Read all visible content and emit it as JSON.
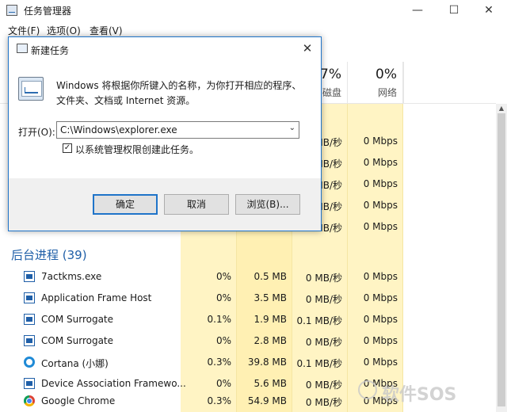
{
  "window": {
    "title": "任务管理器",
    "minimize": "—",
    "maximize": "☐",
    "close": "✕"
  },
  "menu": [
    "文件(F)",
    "选项(O)",
    "查看(V)"
  ],
  "columns": [
    {
      "pct": "",
      "name": ""
    },
    {
      "pct": "",
      "name": ""
    },
    {
      "pct": "7%",
      "name": "磁盘"
    },
    {
      "pct": "0%",
      "name": "网络"
    }
  ],
  "hidden_rows": [
    {
      "disk": "MB/秒",
      "net": "0 Mbps"
    },
    {
      "disk": "MB/秒",
      "net": "0 Mbps"
    },
    {
      "disk": "MB/秒",
      "net": "0 Mbps"
    },
    {
      "disk": "MB/秒",
      "net": "0 Mbps"
    },
    {
      "disk": "MB/秒",
      "net": "0 Mbps"
    }
  ],
  "group": {
    "label": "后台进程 (39)"
  },
  "processes": [
    {
      "name": "7actkms.exe",
      "icon": "window-icon",
      "cpu": "0%",
      "mem": "0.5 MB",
      "disk": "0 MB/秒",
      "net": "0 Mbps"
    },
    {
      "name": "Application Frame Host",
      "icon": "window-icon",
      "cpu": "0%",
      "mem": "3.5 MB",
      "disk": "0 MB/秒",
      "net": "0 Mbps"
    },
    {
      "name": "COM Surrogate",
      "icon": "window-icon",
      "cpu": "0.1%",
      "mem": "1.9 MB",
      "disk": "0.1 MB/秒",
      "net": "0 Mbps"
    },
    {
      "name": "COM Surrogate",
      "icon": "window-icon",
      "cpu": "0%",
      "mem": "2.8 MB",
      "disk": "0 MB/秒",
      "net": "0 Mbps"
    },
    {
      "name": "Cortana (小娜)",
      "icon": "cortana-icon",
      "cpu": "0.3%",
      "mem": "39.8 MB",
      "disk": "0.1 MB/秒",
      "net": "0 Mbps"
    },
    {
      "name": "Device Association Framewo...",
      "icon": "window-icon",
      "cpu": "0%",
      "mem": "5.6 MB",
      "disk": "0 MB/秒",
      "net": "0 Mbps"
    },
    {
      "name": "Google Chrome",
      "icon": "chrome-icon",
      "cpu": "0.3%",
      "mem": "54.9 MB",
      "disk": "0 MB/秒",
      "net": "0 Mbps"
    }
  ],
  "dialog": {
    "title": "新建任务",
    "close": "✕",
    "description": "Windows 将根据你所键入的名称，为你打开相应的程序、文件夹、文档或 Internet 资源。",
    "open_label": "打开(O):",
    "open_value": "C:\\Windows\\explorer.exe",
    "dropdown_arrow": "⌄",
    "admin_checked": true,
    "check_mark": "✓",
    "admin_label": "以系统管理权限创建此任务。",
    "ok": "确定",
    "cancel": "取消",
    "browse": "浏览(B)..."
  },
  "watermark": "软件SOS",
  "colors": {
    "accent": "#1f74c9",
    "usage_bg": "#fff4c4",
    "group_text": "#1f5fa8"
  }
}
